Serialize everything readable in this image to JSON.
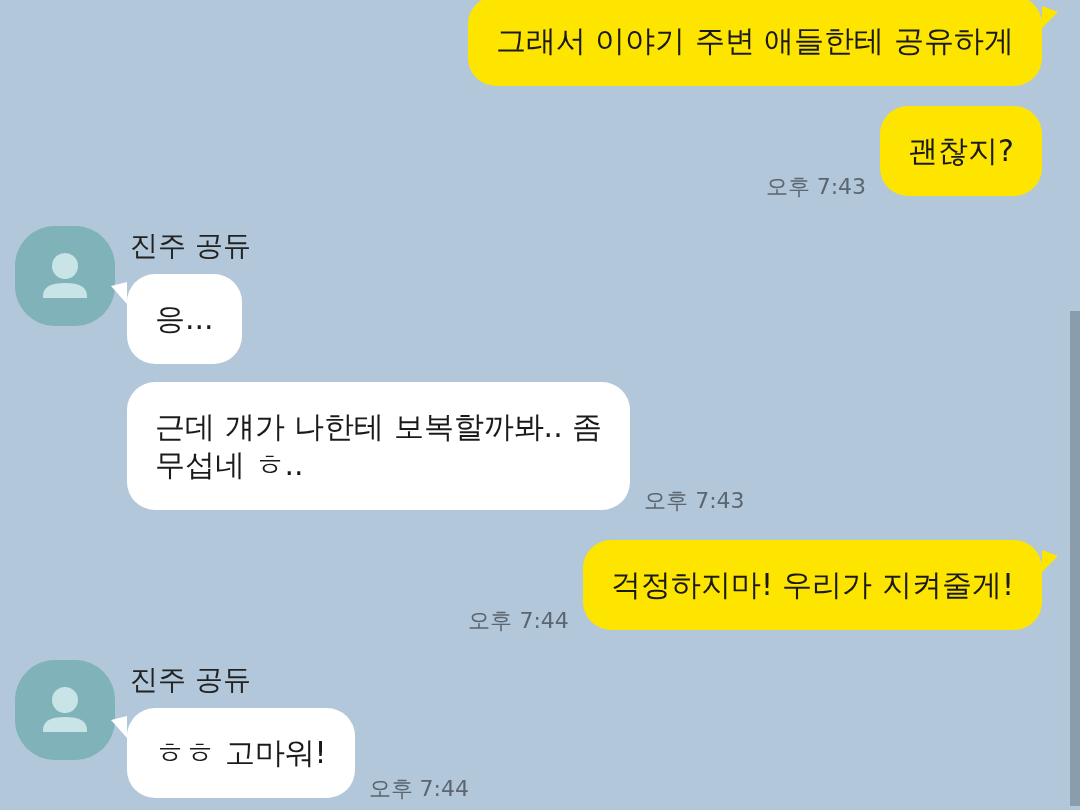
{
  "messages": [
    {
      "kind": "sent",
      "bubbles": [
        {
          "text": "그래서 이야기 주변 애들한테 공유하게"
        },
        {
          "text": "괜찮지?",
          "time": "오후 7:43"
        }
      ]
    },
    {
      "kind": "received",
      "sender": "진주 공듀",
      "bubbles": [
        {
          "text": "응..."
        },
        {
          "text": "근데 걔가 나한테 보복할까봐.. 좀\n무섭네 ㅎ..",
          "time": "오후 7:43"
        }
      ]
    },
    {
      "kind": "sent",
      "bubbles": [
        {
          "text": "걱정하지마! 우리가 지켜줄게!",
          "time": "오후 7:44"
        }
      ]
    },
    {
      "kind": "received",
      "sender": "진주 공듀",
      "bubbles": [
        {
          "text": "ㅎㅎ 고마워!",
          "time": "오후 7:44"
        }
      ]
    }
  ]
}
